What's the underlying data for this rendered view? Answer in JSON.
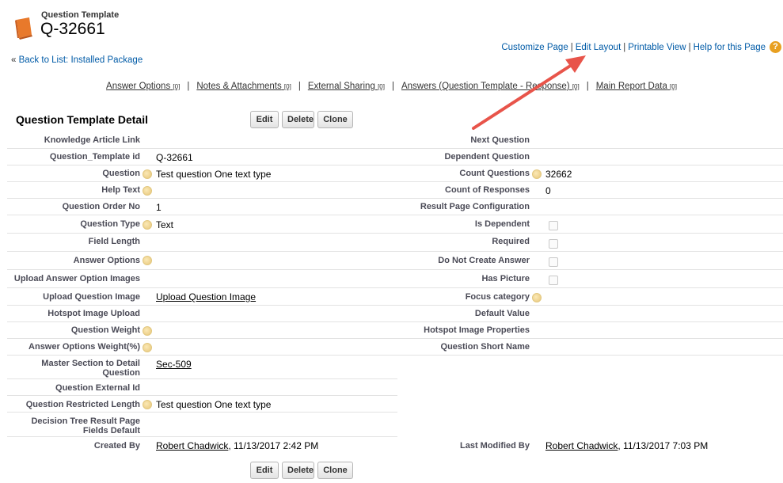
{
  "header": {
    "object_type": "Question Template",
    "record_name": "Q-32661",
    "back_link_prefix": "«",
    "back_link": "Back to List: Installed Package"
  },
  "top_links": {
    "customize": "Customize Page",
    "edit_layout": "Edit Layout",
    "printable": "Printable View",
    "help": "Help for this Page",
    "separator": "|",
    "help_icon": "?"
  },
  "related_lists": [
    {
      "label": "Answer Options",
      "count": "[0]"
    },
    {
      "label": "Notes & Attachments",
      "count": "[0]"
    },
    {
      "label": "External Sharing",
      "count": "[0]"
    },
    {
      "label": "Answers (Question Template - Response)",
      "count": "[0]"
    },
    {
      "label": "Main Report Data",
      "count": "[0]"
    }
  ],
  "section": {
    "title": "Question Template Detail",
    "buttons": {
      "edit": "Edit",
      "delete": "Delete",
      "clone": "Clone"
    }
  },
  "fields": {
    "r1": {
      "left": "Knowledge Article Link",
      "right": "Next Question"
    },
    "r2": {
      "left": "Question_Template id",
      "left_value": "Q-32661",
      "right": "Dependent Question"
    },
    "r3": {
      "left": "Question",
      "left_value": "Test question One text type",
      "right": "Count Questions",
      "right_value": "32662"
    },
    "r4": {
      "left": "Help Text",
      "right": "Count of Responses",
      "right_value": "0"
    },
    "r5": {
      "left": "Question Order No",
      "left_value": "1",
      "right": "Result Page Configuration"
    },
    "r6": {
      "left": "Question Type",
      "left_value": "Text",
      "right": "Is Dependent"
    },
    "r7": {
      "left": "Field Length",
      "right": "Required"
    },
    "r8": {
      "left": "Answer Options",
      "right": "Do Not Create Answer"
    },
    "r9": {
      "left": "Upload Answer Option Images",
      "right": "Has Picture"
    },
    "r10": {
      "left": "Upload Question Image",
      "left_value": "Upload Question Image",
      "right": "Focus category"
    },
    "r11": {
      "left": "Hotspot Image Upload",
      "right": "Default Value"
    },
    "r12": {
      "left": "Question Weight",
      "right": "Hotspot Image Properties"
    },
    "r13": {
      "left": "Answer Options Weight(%)",
      "right": "Question Short Name"
    },
    "r14": {
      "left_line1": "Master Section to Detail",
      "left_line2": "Question",
      "left_value": "Sec-509"
    },
    "r15": {
      "left": "Question External Id"
    },
    "r16": {
      "left": "Question Restricted Length",
      "left_value": "Test question One text type"
    },
    "r17": {
      "left_line1": "Decision Tree Result Page",
      "left_line2": "Fields Default"
    },
    "r18": {
      "left": "Created By",
      "created_user": "Robert Chadwick",
      "created_date": ", 11/13/2017 2:42 PM",
      "right": "Last Modified By",
      "modified_user": "Robert Chadwick",
      "modified_date": ", 11/13/2017 7:03 PM"
    }
  },
  "colors": {
    "link": "#015ba7",
    "label": "#4a4a56",
    "arrow": "#e8544a",
    "icon_orange": "#e8792b"
  }
}
